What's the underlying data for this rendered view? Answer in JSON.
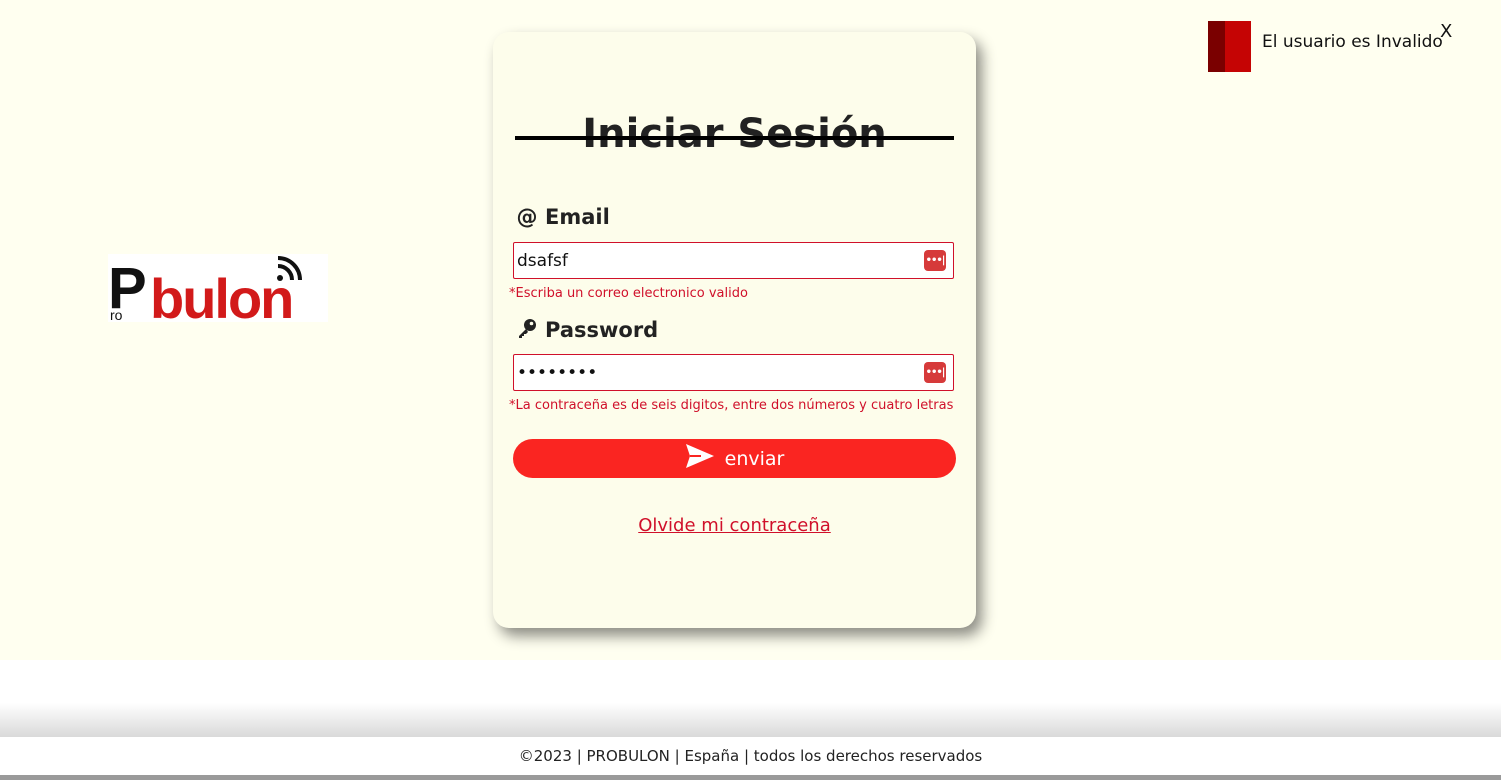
{
  "logo": {
    "text_pro": "Pro",
    "text_main": "bulon",
    "letter_p": "P"
  },
  "login": {
    "title": "Iniciar Sesión",
    "email_label": "Email",
    "email_icon": "at-icon",
    "email_value": "dsafsf",
    "email_error": "*Escriba un correo electronico valido",
    "password_label": "Password",
    "password_icon": "key-icon",
    "password_value": "abcdefgh",
    "password_error": "*La contraceña es de seis digitos, entre dos números y cuatro letras",
    "submit_label": "enviar",
    "submit_icon": "send-icon",
    "forgot_label": "Olvide mi contraceña"
  },
  "toast": {
    "message": "El usuario es Invalido",
    "close_label": "X"
  },
  "footer": {
    "text": "©2023 | PROBULON | España | todos los derechos reservados"
  },
  "colors": {
    "page_bg": "#fffff0",
    "accent": "#fa2521",
    "error": "#d0102a",
    "toast_dark": "#7a0000",
    "toast_red": "#c50404"
  }
}
